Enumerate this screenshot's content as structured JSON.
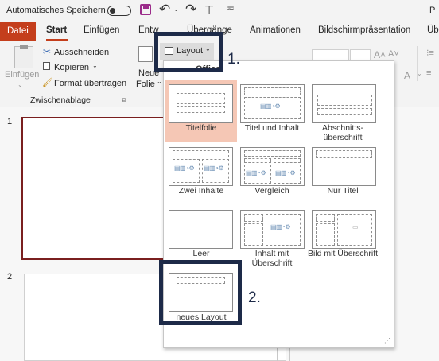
{
  "titlebar": {
    "autosave_label": "Automatisches Speichern",
    "right_partial": "P"
  },
  "tabs": [
    "Datei",
    "Start",
    "Einfügen",
    "Entw",
    "Übergänge",
    "Animationen",
    "Bildschirmpräsentation",
    "Üb"
  ],
  "ribbon": {
    "paste_label": "Einfügen",
    "cut_label": "Ausschneiden",
    "copy_label": "Kopieren",
    "format_label": "Format übertragen",
    "clipboard_group": "Zwischenablage",
    "new_slide_line1": "Neue",
    "new_slide_line2": "Folie",
    "layout_label": "Layout"
  },
  "dropdown": {
    "header": "Office",
    "layouts": [
      {
        "label": "Titelfolie",
        "selected": true
      },
      {
        "label": "Titel und Inhalt"
      },
      {
        "label": "Abschnitts-überschrift"
      },
      {
        "label": "Zwei Inhalte"
      },
      {
        "label": "Vergleich"
      },
      {
        "label": "Nur Titel"
      },
      {
        "label": "Leer"
      },
      {
        "label": "Inhalt mit Überschrift"
      },
      {
        "label": "Bild mit Überschrift"
      },
      {
        "label": "neues Layout"
      }
    ]
  },
  "slides": [
    "1",
    "2"
  ],
  "callouts": {
    "step1": "1.",
    "step2": "2."
  },
  "colors": {
    "accent": "#c43e1c",
    "selected_bg": "#f5c7b5",
    "callout": "#1d2a48",
    "slide_border": "#7a1f1f"
  }
}
